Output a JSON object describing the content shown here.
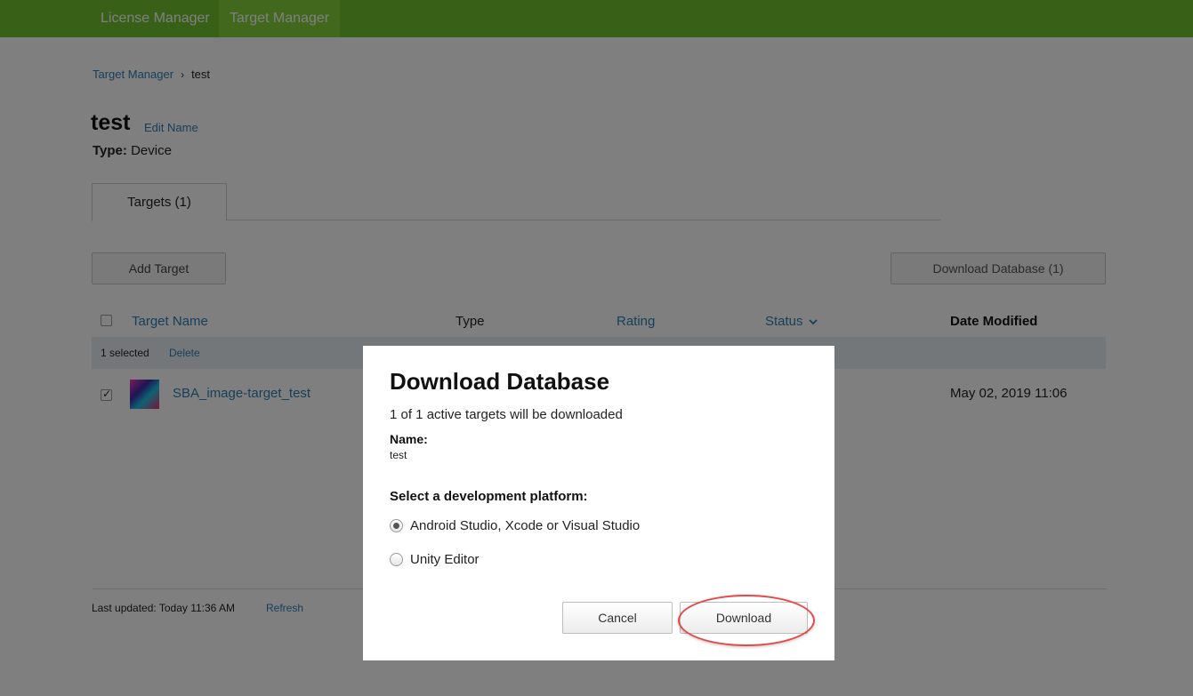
{
  "topnav": {
    "items": [
      {
        "label": "License Manager",
        "active": false
      },
      {
        "label": "Target Manager",
        "active": true
      }
    ]
  },
  "breadcrumb": {
    "root": "Target Manager",
    "separator": "›",
    "current": "test"
  },
  "database": {
    "name": "test",
    "edit_label": "Edit Name",
    "type_label": "Type:",
    "type_value": "Device"
  },
  "tabs": [
    {
      "label": "Targets (1)",
      "active": true
    }
  ],
  "toolbar": {
    "add_target_label": "Add Target",
    "download_database_label": "Download Database (1)"
  },
  "table": {
    "headers": {
      "name": "Target Name",
      "type": "Type",
      "rating": "Rating",
      "status": "Status",
      "date": "Date Modified"
    },
    "selection": {
      "text": "1 selected",
      "delete_label": "Delete"
    },
    "rows": [
      {
        "name": "SBA_image-target_test",
        "date_modified": "May 02, 2019 11:06",
        "checked": true
      }
    ]
  },
  "footer": {
    "last_updated": "Last updated: Today 11:36 AM",
    "refresh_label": "Refresh"
  },
  "modal": {
    "title": "Download Database",
    "description": "1 of 1 active targets will be downloaded",
    "name_label": "Name:",
    "name_value": "test",
    "platform_label": "Select a development platform:",
    "options": [
      {
        "label": "Android Studio, Xcode or Visual Studio",
        "selected": true
      },
      {
        "label": "Unity Editor",
        "selected": false
      }
    ],
    "cancel_label": "Cancel",
    "download_label": "Download"
  },
  "colors": {
    "nav_green": "#73c12e",
    "link_blue": "#2f7fb3",
    "annotation_red": "#e54848",
    "selection_bar": "#e9eef5"
  },
  "icons": {
    "status_sort": "chevron-down-icon",
    "breadcrumb_sep": "chevron-right-icon"
  }
}
